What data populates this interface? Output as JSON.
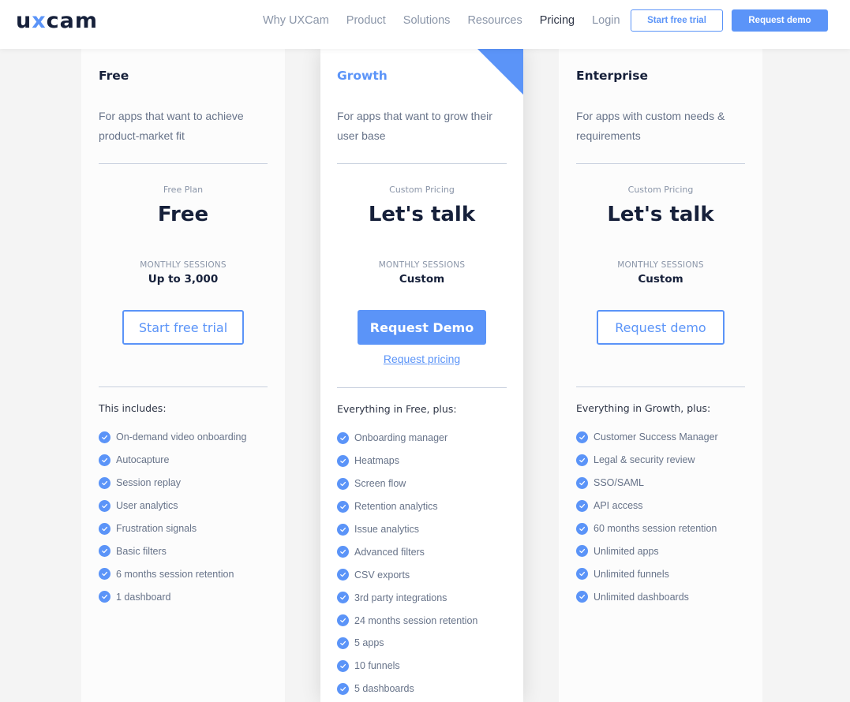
{
  "header": {
    "logo": {
      "pre": "u",
      "x": "x",
      "post": "cam"
    },
    "nav": [
      {
        "label": "Why UXCam",
        "active": false
      },
      {
        "label": "Product",
        "active": false
      },
      {
        "label": "Solutions",
        "active": false
      },
      {
        "label": "Resources",
        "active": false
      },
      {
        "label": "Pricing",
        "active": true
      },
      {
        "label": "Login",
        "active": false
      }
    ],
    "start_trial_label": "Start free trial",
    "request_demo_label": "Request demo"
  },
  "colors": {
    "accent": "#5b94f8",
    "text_dark": "#16203a",
    "text_muted": "#677389",
    "background": "#f4f4f4"
  },
  "plans": {
    "free": {
      "name": "Free",
      "description": "For apps that want to achieve product-market fit",
      "price_label": "Free Plan",
      "price": "Free",
      "sessions_label": "MONTHLY SESSIONS",
      "sessions_value": "Up to 3,000",
      "cta_label": "Start free trial",
      "includes_title": "This includes:",
      "features": [
        "On-demand video onboarding",
        "Autocapture",
        "Session replay",
        "User analytics",
        "Frustration signals",
        "Basic filters",
        "6 months session retention",
        "1 dashboard"
      ]
    },
    "growth": {
      "name": "Growth",
      "description": "For apps that want to grow their user base",
      "price_label": "Custom Pricing",
      "price": "Let's talk",
      "sessions_label": "MONTHLY SESSIONS",
      "sessions_value": "Custom",
      "cta_label": "Request Demo",
      "link_label": "Request pricing",
      "includes_title": "Everything in Free, plus:",
      "features": [
        "Onboarding manager",
        "Heatmaps",
        "Screen flow",
        "Retention analytics",
        "Issue analytics",
        "Advanced filters",
        "CSV exports",
        "3rd party integrations",
        "24 months session retention",
        "5 apps",
        "10 funnels",
        "5 dashboards"
      ]
    },
    "enterprise": {
      "name": "Enterprise",
      "description": "For apps with custom needs & requirements",
      "price_label": "Custom Pricing",
      "price": "Let's talk",
      "sessions_label": "MONTHLY SESSIONS",
      "sessions_value": "Custom",
      "cta_label": "Request demo",
      "includes_title": "Everything in Growth, plus:",
      "features": [
        "Customer Success Manager",
        "Legal & security review",
        "SSO/SAML",
        "API access",
        "60 months session retention",
        "Unlimited apps",
        "Unlimited funnels",
        "Unlimited dashboards"
      ]
    }
  }
}
